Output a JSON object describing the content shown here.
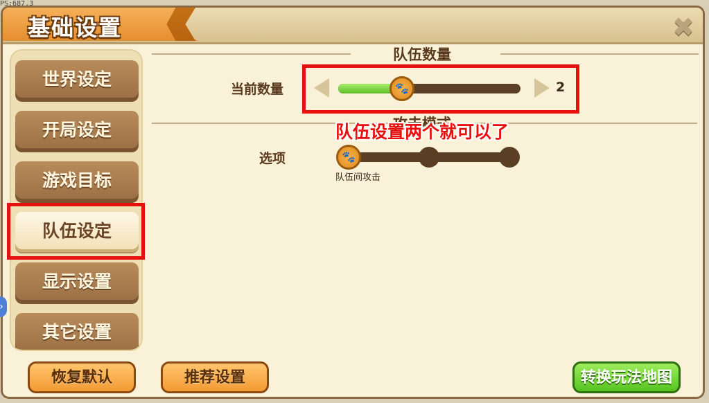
{
  "overlay": {
    "fps": "PS:687.3"
  },
  "window": {
    "title": "基础设置"
  },
  "sidebar": {
    "items": [
      {
        "label": "世界设定"
      },
      {
        "label": "开局设定"
      },
      {
        "label": "游戏目标"
      },
      {
        "label": "队伍设定"
      },
      {
        "label": "显示设置"
      },
      {
        "label": "其它设置"
      }
    ],
    "active_index": 3
  },
  "team_count": {
    "section_title": "队伍数量",
    "label": "当前数量",
    "value": "2",
    "slider_fraction": 0.35
  },
  "attack_mode": {
    "section_title": "攻击模式",
    "label": "选项",
    "selected_option": "队伍间攻击",
    "option_count": 3,
    "selected_index": 0
  },
  "annotation": {
    "text": "队伍设置两个就可以了",
    "color": "#e8100e"
  },
  "footer": {
    "restore_label": "恢复默认",
    "recommend_label": "推荐设置",
    "switch_map_label": "转换玩法地图"
  },
  "colors": {
    "accent_orange": "#f39a33",
    "accent_green": "#56c420",
    "highlight_red": "#e8100e"
  }
}
